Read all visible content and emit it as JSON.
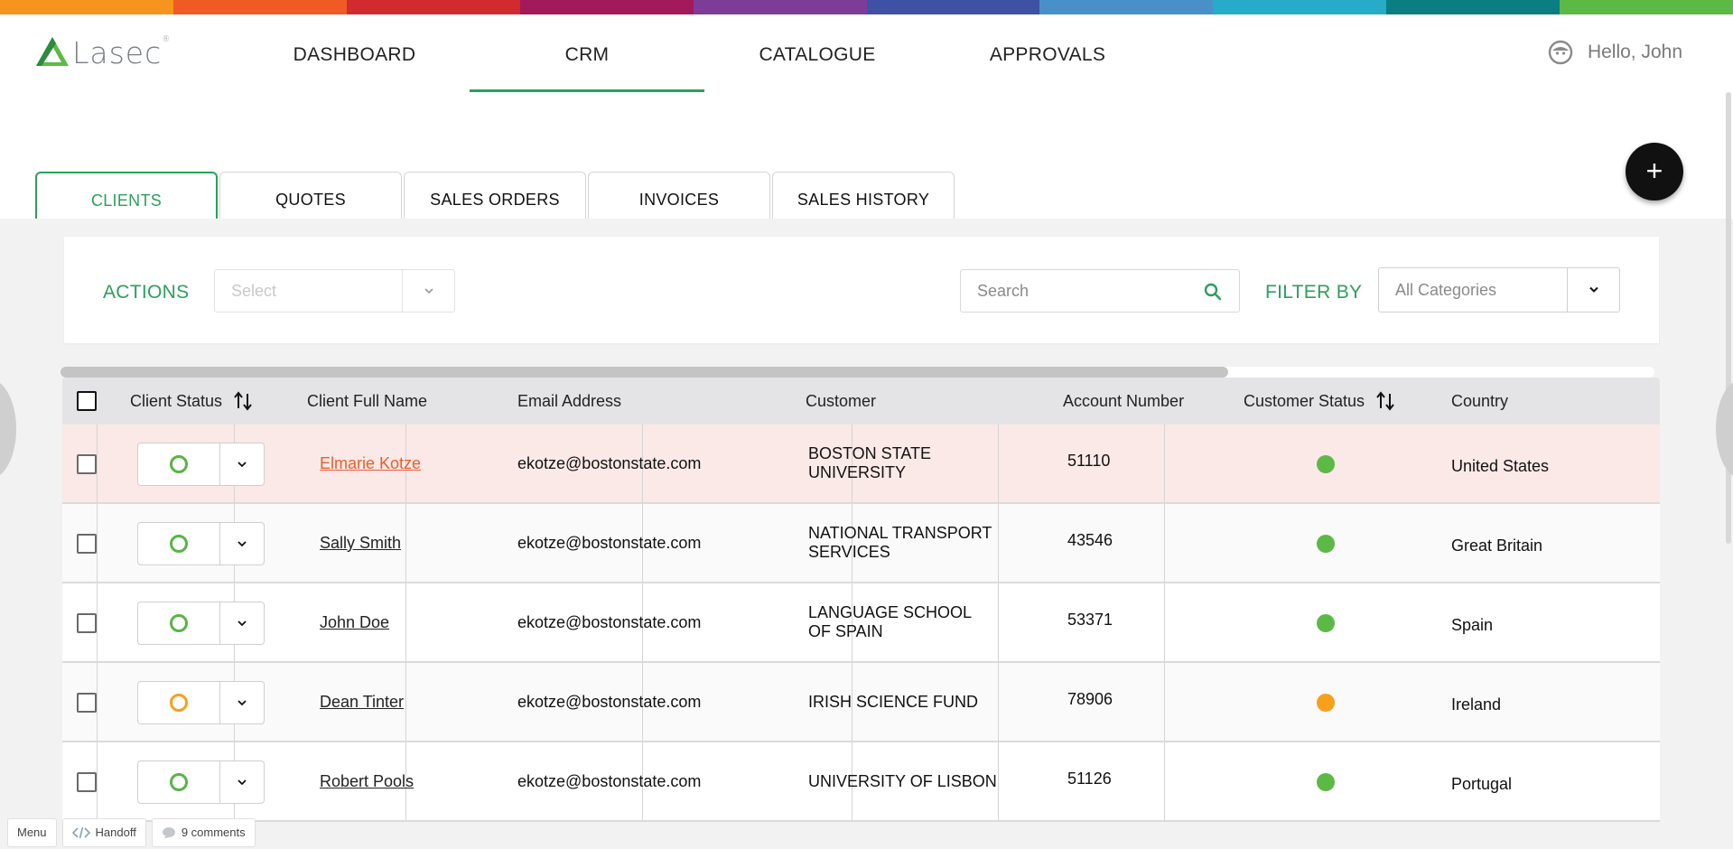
{
  "brand": {
    "name": "Lasec",
    "accent": "#2ba05a"
  },
  "rainbow_colors": [
    "#f7941d",
    "#f15a24",
    "#d12a2f",
    "#a3195b",
    "#7d3c98",
    "#3f51a3",
    "#4a90c8",
    "#26abc9",
    "#0b7e82",
    "#5db946"
  ],
  "nav": {
    "items": [
      {
        "label": "DASHBOARD"
      },
      {
        "label": "CRM"
      },
      {
        "label": "CATALOGUE"
      },
      {
        "label": "APPROVALS"
      }
    ],
    "active": "CRM"
  },
  "user": {
    "greeting": "Hello, John",
    "icon": "user-avatar-icon"
  },
  "tabs": [
    {
      "label": "CLIENTS"
    },
    {
      "label": "QUOTES"
    },
    {
      "label": "SALES ORDERS"
    },
    {
      "label": "INVOICES"
    },
    {
      "label": "SALES HISTORY"
    }
  ],
  "active_tab": "CLIENTS",
  "toolbar": {
    "actions_label": "ACTIONS",
    "actions_placeholder": "Select",
    "search_placeholder": "Search",
    "filter_label": "FILTER BY",
    "filter_placeholder": "All Categories",
    "add_label": "+"
  },
  "table": {
    "columns": [
      "Client Status",
      "Client Full Name",
      "Email Address",
      "Customer",
      "Account Number",
      "Customer Status",
      "Country"
    ],
    "rows": [
      {
        "name": "Elmarie Kotze",
        "email": "ekotze@bostonstate.com",
        "customer": "BOSTON STATE UNIVERSITY",
        "account": "51110",
        "status_color": "#5cb946",
        "client_status_color": "#58b446",
        "country": "United States"
      },
      {
        "name": "Sally Smith",
        "email": "ekotze@bostonstate.com",
        "customer": "NATIONAL TRANSPORT SERVICES",
        "account": "43546",
        "status_color": "#5cb946",
        "client_status_color": "#58b446",
        "country": "Great Britain"
      },
      {
        "name": "John Doe",
        "email": "ekotze@bostonstate.com",
        "customer": "LANGUAGE SCHOOL OF SPAIN",
        "account": "53371",
        "status_color": "#5cb946",
        "client_status_color": "#58b446",
        "country": "Spain"
      },
      {
        "name": "Dean Tinter",
        "email": "ekotze@bostonstate.com",
        "customer": "IRISH SCIENCE FUND",
        "account": "78906",
        "status_color": "#f7a01b",
        "client_status_color": "#f7a01b",
        "country": "Ireland"
      },
      {
        "name": "Robert Pools",
        "email": "ekotze@bostonstate.com",
        "customer": "UNIVERSITY OF LISBON",
        "account": "51126",
        "status_color": "#5cb946",
        "client_status_color": "#58b446",
        "country": "Portugal"
      }
    ]
  },
  "bottom_bar": {
    "menu": "Menu",
    "handoff": "Handoff",
    "comments": "9 comments"
  }
}
